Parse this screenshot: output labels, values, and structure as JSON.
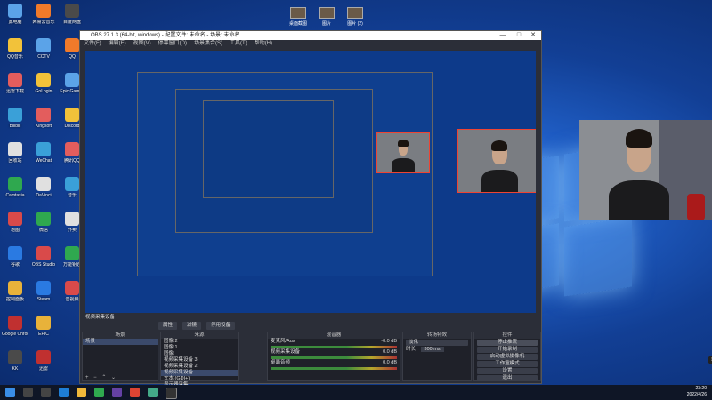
{
  "window": {
    "title": "OBS 27.1.3 (64-bit, windows) - 配置文件: 未命名 - 场景: 未命名",
    "menu": [
      "文件(F)",
      "编辑(E)",
      "视图(V)",
      "停靠窗口(D)",
      "场景集合(S)",
      "工具(T)",
      "帮助(H)"
    ],
    "controls": {
      "minimize": "—",
      "maximize": "□",
      "close": "✕"
    }
  },
  "scene_info": "视频采集设备",
  "control_bar": {
    "properties": "属性",
    "filters": "滤镜",
    "deactivate": "停用设备"
  },
  "docks": {
    "scenes": {
      "header": "场景",
      "items": [
        "场景"
      ]
    },
    "sources": {
      "header": "来源",
      "items": [
        "图像 2",
        "图像 1",
        "图像",
        "视频采集设备 3",
        "视频采集设备 2",
        "视频采集设备",
        "文本 (GDI+)",
        "显示器采集"
      ]
    },
    "mixer": {
      "header": "混音器",
      "channels": [
        {
          "name": "麦克风/Aux",
          "db": "-0.0 dB"
        },
        {
          "name": "视频采集设备",
          "db": "0.0 dB"
        },
        {
          "name": "桌面音频",
          "db": "0.0 dB"
        }
      ]
    },
    "transitions": {
      "header": "转场特效",
      "type": "淡化",
      "duration_label": "时长",
      "duration_value": "300 ms"
    },
    "controls": {
      "header": "控件",
      "buttons": [
        "停止推流",
        "开始录制",
        "启动虚拟摄像机",
        "工作室模式",
        "设置",
        "退出"
      ]
    },
    "footer": "+ − ⌃ ⌄"
  },
  "desktop": {
    "icons": [
      "此电脑",
      "QQ音乐",
      "迅雷下载",
      "Bilibili",
      "回收站",
      "Camtasia",
      "地图",
      "谷歌",
      "控制面板",
      "Google Chrome",
      "KK",
      "网易云音乐",
      "CCTV",
      "GoLogin",
      "Kingsoft",
      "WeChat",
      "DaVinci",
      "微信",
      "OBS Studio",
      "Steam",
      "EPIC",
      "迅雷",
      "百度网盘",
      "QQ",
      "Epic Games",
      "Discord",
      "腾讯QQ",
      "音乐",
      "外卖",
      "万能钥匙",
      "音视频"
    ],
    "top_icons": [
      "桌面截图",
      "图片",
      "图片 (2)"
    ]
  },
  "taskbar": {
    "time": "23:20",
    "date": "2022/4/26"
  },
  "colors": {
    "accent": "#3c8b3c",
    "selection": "#e43"
  }
}
